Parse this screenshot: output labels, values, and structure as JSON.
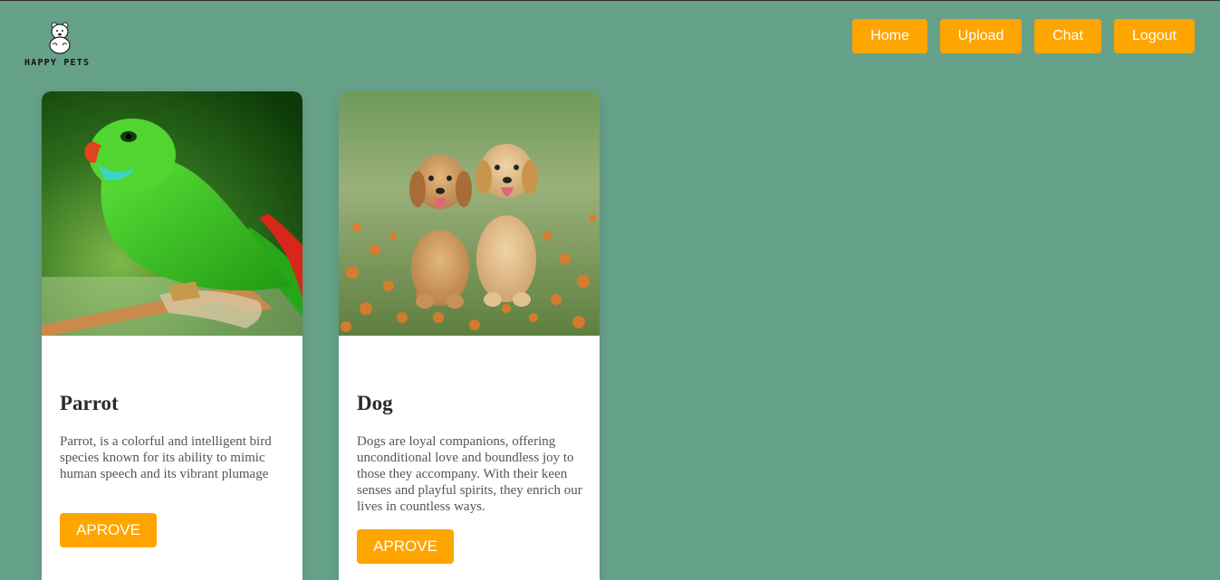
{
  "brand": {
    "name": "HAPPY PETS",
    "logo_icon": "bear-icon"
  },
  "nav": {
    "items": [
      {
        "label": "Home"
      },
      {
        "label": "Upload"
      },
      {
        "label": "Chat"
      },
      {
        "label": "Logout"
      }
    ]
  },
  "cards": [
    {
      "title": "Parrot",
      "description": "Parrot, is a colorful and intelligent bird species known for its ability to mimic human speech and its vibrant plumage",
      "button_label": "APROVE",
      "image": "parrot-photo"
    },
    {
      "title": "Dog",
      "description": "Dogs are loyal companions, offering unconditional love and boundless joy to those they accompany. With their keen senses and playful spirits, they enrich our lives in countless ways.",
      "button_label": "APROVE",
      "image": "dog-photo"
    }
  ],
  "colors": {
    "background": "#66a18a",
    "accent": "#ffa500",
    "card": "#ffffff"
  }
}
